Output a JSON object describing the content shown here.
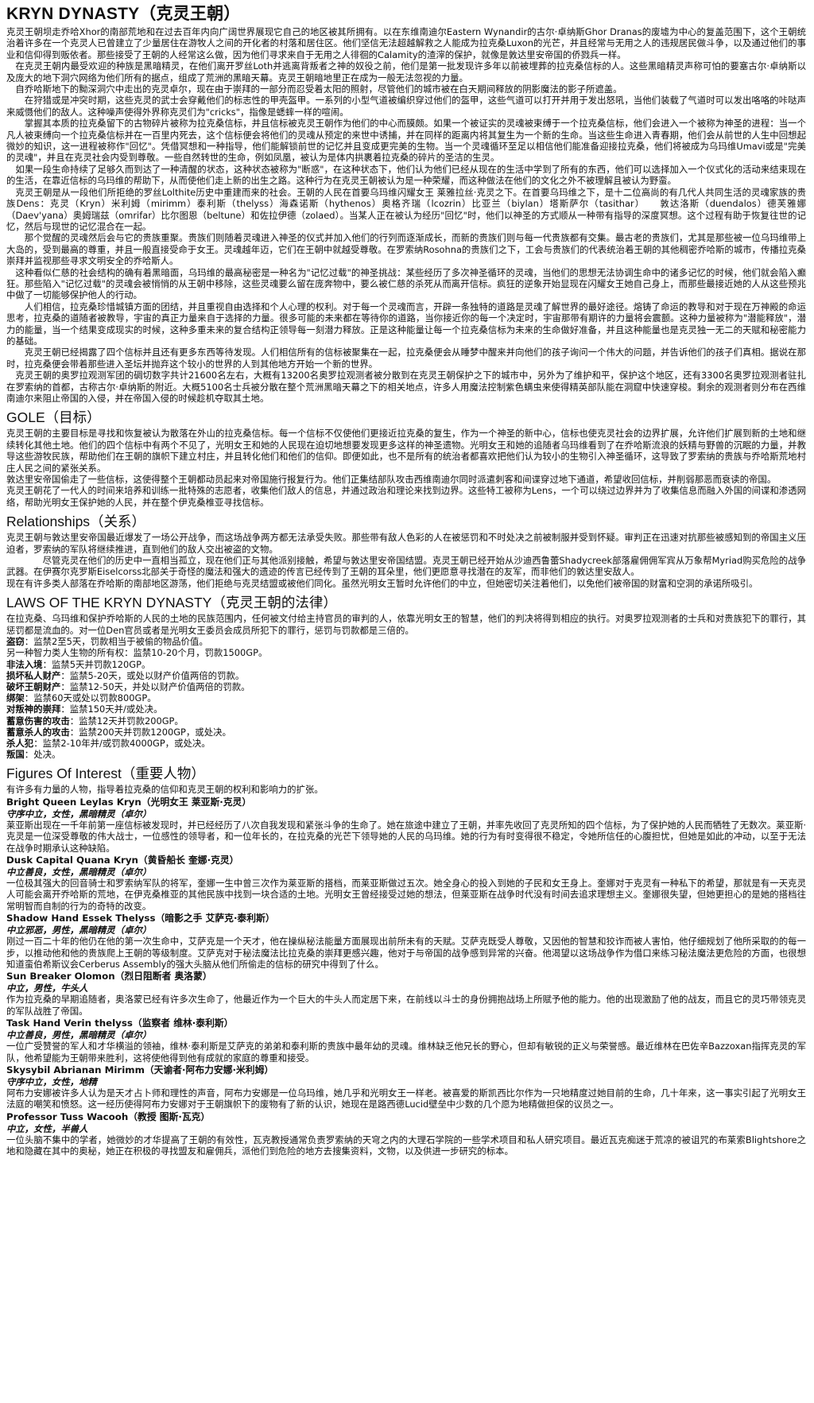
{
  "title": "KRYN DYNASTY（克灵王朝）",
  "intro_paragraphs": [
    {
      "cls": "",
      "text": "克灵王朝坝走乔哈Xhor的南部荒地和在过去百年内向广阔世界展现它自己的地区被其所拥有。以在东维南迪尔Eastern Wynandir的古尔·卓纳斯Ghor Dranas的废墟为中心的复盖范围下，这个王朝统治着许多在一个克灵人已曾建立了少量居住在游牧人之间的开化者的村落和居住区。他们坚信无法超越解救之人能成为拉克桑Luxon的光芒，并且经常与无用之人的违规居民做斗争，以及通过他们的事业和信仰得到贩依者。那些接受了王朝的人经常这么做，因为他们寻求来自于无用之人徘徊的Calamity的渣滓的保护，就像是敦达里安帝国的侨戮兵一样。"
    },
    {
      "cls": "ind",
      "text": "在克灵王朝内最受欢迎的种族是黑暗精灵，在他们离开罗丝Loth并逃离背叛者之神的奴役之前，他们是第一批发现许多年以前被埋葬的拉克桑信标的人。这些黑暗精灵声称可怕的要塞古尔·卓纳斯以及庞大的地下洞穴网络为他们所有的据点，组成了荒洲的黑暗天幕。克灵王朝暗地里正在成为一般无法忽视的力量。"
    },
    {
      "cls": "ind",
      "text": "自乔哈斯地下的黝深洞穴中走出的克灵卓尔，现在由于崇拜的一部分而忍受着太阳的照射，尽管他们的城市被在白天期间释放的阴影魔法的影子所遮盖。"
    },
    {
      "cls": "ind2",
      "text": "在狩猎或是冲突时期，这些克灵的武士会穿戴他们的标志性的甲壳盔甲。一系列的小型气道被编织穿过他们的盔甲，这些气道可以打开并用于发出怒吼，当他们装载了气道时可以发出咯咯的咔哒声来威慑他们的敌人。这种噪声使得外界称克灵们为\"cricks\"，指像是蟋蟀一样的喧闹。"
    },
    {
      "cls": "ind2",
      "text": "掌握其本质的拉克桑留下的古物碎片被称为拉克桑信标，并且信标被克灵王朝作为他们的中心而膜颇。如果一个被证实的灵魂被束缚于一个拉克桑信标，他们会进入一个被称为神圣的进程：当一个凡人被束缚向一个拉克桑信标并在一百里内死去，这个信标便会将他们的灵魂从预定的来世中诱捕，并在同样的距离内将其复生为一个新的生命。当这些生命进入青春期，他们会从前世的人生中回想起微妙的知识，这一进程被称作\"回忆\"。凭借冥想和一种指导，他们能解锁前世的记忆并且变成更完美的生物。当一个灵魂循环至足以相信他们能准备迎接拉克桑，他们将被成为乌玛维Umavi或是\"完美的灵魂\"，并且在克灵社会内受到尊敬。一些自然转世的生命，例如凤凰，被认为是体内拱裹着拉克桑的碎片的圣洁的生灵。"
    },
    {
      "cls": "ind",
      "text": "如果一段生命持续了足够久而到达了一种清醒的状态，这种状态被称为\"断惑\"，在这种状态下，他们认为他们已经从现在的生活中学到了所有的东西，他们可以选择加入一个仪式化的活动来结束现在的生活，在靠近信标的乌玛维的帮助下，从而使他们走上新的出生之路。这种行为在克灵王朝被认为是一种荣耀，而这种做法在他们的文化之外不被理解且被认为野蛮。"
    },
    {
      "cls": "ind",
      "text": "克灵王朝是从一段他们所拒绝的罗丝Lolthite历史中重建而来的社会。王朝的人民在首要乌玛维闪耀女王 莱雅拉丝·克灵之下。在首要乌玛维之下，是十二位高尚的有几代人共同生活的灵魂家族的贵族Dens：克灵（Kryn）米利姆（mirimm）泰利斯（thelyss）海森诺斯（hythenos）奥格齐瑞（lcozrin）比亚兰（biylan）塔斯萨尔（tasithar）　　敦达洛斯（duendalos）德芙雅娜（Daev'yana）奥姆瑞兹（omrifar）比尔图恩（beltune）和佐拉伊德（zolaed）。当某人正在被认为经历\"回忆\"时，他们以神圣的方式顺从一种带有指导的深度冥想。这个过程有助于恢复往世的记忆，然后与现世的记忆混合在一起。"
    },
    {
      "cls": "ind2",
      "text": "那个觉醒的灵魂然后会与它的贵族重聚。贵族们则随着灵魂进入神圣的仪式并加入他们的行列而逐渐成长，而新的贵族们则与每一代贵族都有交集。最古老的贵族们，尤其是那些被一位乌玛维带上大岛的，受到最高的尊重，并且一般直接受命于女王。灵魂越年迈，它们在王朝中就越受尊敬。在罗索纳Rosohna的贵族们之下，工会与贵族们的代表统治着王朝的其他稠密乔哈斯的城市，传播拉克桑崇拜并监视那些寻求文明安全的乔哈斯人。"
    },
    {
      "cls": "ind",
      "text": "这种看似仁慈的社会结构的确有着黑暗面，乌玛维的最高秘密是一种名为\"记忆过载\"的神圣挑战：某些经历了多次神圣循环的灵魂，当他们的思想无法协调生命中的诸多记忆的时候，他们就会陷入癫狂。那些陷入\"记忆过载\"的灵魂会被悄悄的从王朝中移除，这些灵魂要么留在庞奔物中，要么被仁慈的杀死从而离开信标。疯狂的逆象开始显现在闪耀女王她自己身上，而那些最接近她的人从这些预兆中做了一切能够保护他人的行动。"
    },
    {
      "cls": "ind2",
      "text": "人们相信，拉克桑珍惜城镇方面的团结，并且重视自由选择和个人心理的权利。对于每一个灵魂而言，开辟一条独特的道路是灵魂了解世界的最好途径。熔铸了命运的教导和对于现在万神殿的命运思考，拉克桑的道随者被教导，宇宙的真正力量来自于选择的力量。很多可能的未来都在等待你的道路，当你接近你的每一个决定时，宇宙那带有期许的力量将会震颤。这种力量被称为\"潜能释放\"，潜力的能量，当一个结果变成现实的时候，这种多重未来的复合结构正领导每一刻潜力释放。正是这种能量让每一个拉克桑信标为未来的生命做好准备，并且这种能量也是克灵独一无二的天赋和秘密能力的基础。"
    },
    {
      "cls": "ind2",
      "text": "克灵王朝已经揭露了四个信标并且还有更多东西等待发现。人们相信所有的信标被聚集在一起，拉克桑便会从睡梦中醒来并向他们的孩子询问一个伟大的问题，并告诉他们的孩子们真相。据说在那时，拉克桑便会带着那些进入圣坛并抛弃这个较小的世界的人到其他地方开始一个新的世界。"
    },
    {
      "cls": "ind",
      "text": "克灵王朝的奥罗拉观测军团的碉切数字共计21600名左右，大概有13200名奥罗拉观测者被分散到在克灵王朝保护之下的城市中，另外为了维护和平，保护这个地区，还有3300名奥罗拉观测者驻扎在罗索纳的首都，古称古尔·卓纳斯的附近。大概5100名士兵被分散在整个荒洲黑暗天幕之下的相关地点，许多人用魔法控制紫色螨虫来使得精英部队能在洞窟中快速穿梭。剩余的观测者则分布在西维南迪尔来阻止帝国的入侵，并在帝国入侵的时候趁机夺取其土地。"
    }
  ],
  "goal": {
    "heading": "GOLE（目标）",
    "paragraphs": [
      "克灵王朝的主要目标是寻找和恢复被认为散落在外山的拉克桑信标。每一个信标不仅使他们更接近拉克桑的复生，作为一个神圣的新中心，信标也使克灵社会的边界扩展，允许他们扩展到新的土地和继续转化其他土地。他们的四个信标中有两个不见了，光明女王和她的人民现在迫切地想要发现更多这样的神圣遗物。光明女王和她的追随者乌玛维看到了在乔哈斯流浪的妖精与野兽的沉眠的力量，并教导这些游牧民族，帮助他们在王朝的旗帜下建立村庄，并且转化他们和他们的信仰。即便如此，也不是所有的统治者都喜欢把他们认为较小的生物引入神圣循环，这导致了罗索纳的贵族与乔哈斯荒地村庄人民之间的紧张关系。",
      "敦达里安帝国偷走了一些信标，这使得整个王朝都动员起来对帝国施行报复行为。他们正集结部队攻击西维南迪尔同时派遣刺客和间谍穿过地下通道，希望收回信标，并削弱那恶而衰读的帝国。",
      "克灵王朝花了一代人的时间来培养和训练一批特殊的志愿者，收集他们敌人的信息，并通过政治和理论来找到边界。这些特工被称为Lens，一个可以绕过边界并为了收集信息而融入外国的间谍和渗透网络，帮助光明女王保护她的人民，并在整个伊克桑椎亚寻找信标。"
    ]
  },
  "relationships": {
    "heading": "Relationships（关系）",
    "paragraphs": [
      {
        "cls": "",
        "text": "克灵王朝与敦达里安帝国最近爆发了一场公开战争，而这场战争两方都无法承受失败。那些带有敌人色彩的人在被惩罚和不时处决之前被制服并受到怀疑。审判正在迅速对抗那些被感知到的帝国主义压迫者，罗索纳的军队将继续推进，直到他们的敌人交出被盗的文物。"
      },
      {
        "cls": "ind",
        "text": "　　　尽管克灵在他们的历史中一直相当孤立，现在他们正与其他派别接触，希望与敦达里安帝国结盟。克灵王朝已经开始从沙迪西鲁蕾Shadycreek部落雇佣佣军宾从万象帮Myriad购买危险的战争武器。在伊赛尔克罗斯Eiselcorss北部关于奇怪的魔法和强大的遗迹的传言已经传到了王朝的耳朵里，他们更愿意寻找潜在的友军，而非他们的敦达里安敌人。"
      },
      {
        "cls": "",
        "text": "现在有许多类人部落在乔哈斯的南部地区游荡，他们拒绝与克灵结盟或被他们同化。虽然光明女王暂时允许他们的中立，但她密切关注着他们，以免他们被帝国的财富和空洞的承诺所吸引。"
      }
    ]
  },
  "laws": {
    "heading": "LAWS OF THE KRYN DYNASTY（克灵王朝的法律）",
    "intro": "在拉克桑、乌玛维和保护乔哈斯的人民的土地的民族范围内，任何被文付给主持官员的审判的人，依靠光明女王的智慧，他们的判决将得到相应的执行。对奥罗拉观测者的士兵和对贵族犯下的罪行，其惩罚都是流血的。对一位Den官员或者是光明女王委员会成员所犯下的罪行，惩罚与罚款都是三倍的。",
    "items": [
      {
        "name": "盗窃",
        "text": "：监禁2至5天，罚款相当于被偷的物品价值。"
      },
      {
        "name": "",
        "text": "另一种智力类人生物的所有权：监禁10-20个月，罚款1500GP。"
      },
      {
        "name": "非法入境",
        "text": "：监禁5天并罚款120GP。"
      },
      {
        "name": "损坏私人财产",
        "text": "：监禁5-20天，或处以财产价值两倍的罚款。"
      },
      {
        "name": "破坏王朝财产",
        "text": "：监禁12-50天，并处以财产价值两倍的罚款。"
      },
      {
        "name": "绑架",
        "text": "：监禁60天或处以罚款800GP。"
      },
      {
        "name": "对叛神的崇拜",
        "text": "：监禁150天并/或处决。"
      },
      {
        "name": "蓄意伤害的攻击",
        "text": "：监禁12天并罚款200GP。"
      },
      {
        "name": "蓄意杀人的攻击",
        "text": "：监禁200天并罚款1200GP，或处决。"
      },
      {
        "name": "杀人犯",
        "text": "：监禁2-10年并/或罚款4000GP，或处决。"
      },
      {
        "name": "叛国",
        "text": "：处决。"
      }
    ]
  },
  "figures": {
    "heading": "Figures Of Interest（重要人物）",
    "intro": "有许多有力量的人物，指导着拉克桑的信仰和克灵王朝的权利和影响力的扩张。",
    "people": [
      {
        "name": "Bright Queen Leylas Kryn（光明女王 莱亚斯·克灵）",
        "meta": "守序中立，女性，黑暗精灵（卓尔）",
        "desc": "莱亚斯出现在一千年前第一座信标被发现时，并已经经历了八次自我发现和紧张斗争的生命了。她在旅途中建立了王朝，并率先收回了克灵所知的四个信标，为了保护她的人民而牺牲了无数次。莱亚斯·克灵是一位深受尊敬的伟大战士，一位感性的领导者，和一位年长的，在拉克桑的光芒下领导她的人民的乌玛维。她的行为有时变得很不稳定，令她所信任的心腹担忧，但她是如此的冲动，以至于无法在战争时期承认这种缺陷。"
      },
      {
        "name": "Dusk Capital Quana Kryn（黄昏船长 奎娜·克灵）",
        "meta": "中立善良，女性，黑暗精灵（卓尔）",
        "desc": "一位极其强大的回音骑士和罗索纳军队的将军，奎娜一生中曾三次作为莱亚斯的搭档，而莱亚斯做过五次。她全身心的投入到她的子民和女王身上。奎娜对于克灵有一种私下的希望，那就是有一天克灵人可能会离开乔哈斯的荒地，在伊克桑椎亚的其他民族中找到一块合适的土地。光明女王曾经接受过她的想法，但莱亚斯在战争时代没有时间去追求理想主义。奎娜很失望，但她更担心的是她的搭档往常明智而自制的行为的奇特的改变。"
      },
      {
        "name": "Shadow Hand Essek Thelyss（暗影之手 艾萨克·泰利斯）",
        "meta": "中立邪恶，男性，黑暗精灵（卓尔）",
        "desc": "刚过一百二十年的他仍在他的第一次生命中，艾萨克是一个天才，他在操纵秘法能量方面展现出前所未有的天赋。艾萨克既受人尊敬，又因他的智慧和狡诈而被人害怕，他仔细规划了他所采取的的每一步，以推动他和他的贵族爬上王朝的等级制度。艾萨克对于秘法魔法比拉克桑的崇拜更感兴趣，他对于与帝国的战争感到异常的兴奋。他渴望以这场战争作为借口来练习秘法魔法更危险的方面，也很想知道蛮伯希斯议会Cerberus Assembly的强大头脑从他们所偷走的信标的研究中得到了什么。"
      },
      {
        "name": "Sun Breaker Olomon（烈日阻断者 奥洛蒙）",
        "meta": "中立，男性，牛头人",
        "desc": "作为拉克桑的早期追随者，奥洛蒙已经有许多次生命了，他最近作为一个巨大的牛头人而定居下来，在前线以斗士的身份拥抱战场上所赋予他的能力。他的出现激励了他的战友，而且它的灵巧带领克灵的军队战胜了帝国。"
      },
      {
        "name": "Task Hand Verin thelyss（监察者 维林·泰利斯）",
        "meta": "中立善良，男性，黑暗精灵（卓尔）",
        "desc": "一位广受赞誉的军人和才华横溢的领袖，维林·泰利斯是艾萨克的弟弟和泰利斯的贵族中最年幼的灵魂。维林缺乏他兄长的野心，但却有敏锐的正义与荣誉感。最近维林在巴佐辛Bazzoxan指挥克灵的军队，他希望能为王朝带来胜利，这将使他得到他有成就的家庭的尊重和接受。"
      },
      {
        "name": "Skysybil Abrianan Mirimm（天谕者·阿布力安娜·米利姆）",
        "meta": "守序中立，女性，地精",
        "desc": "阿布力安娜被许多人认为是天才占卜师和理性的声音，阿布力安娜是一位乌玛维，她几乎和光明女王一样老。被喜爱的斯凯西比尔作为一只地精度过她目前的生命，几十年来，这一事实引起了光明女王法庭的嘲笑和愤怒。这一经历使得阿布力安娜对于王朝旗帜下的废物有了新的认识，她现在是路西德Lucid壁垒中少数的几个愿为地精做担保的议员之一。"
      },
      {
        "name": "Professor Tuss Wacooh（教授 图斯·瓦克）",
        "meta": "中立，女性，半兽人",
        "desc": "一位头脑不集中的学者，她微妙的才华提高了王朝的有效性，瓦克教授通常负责罗索纳的天穹之内的大理石学院的一些学术项目和私人研究项目。最近瓦克痴迷于荒凉的被诅咒的布莱索Blightshore之地和隐藏在其中的奥秘，她正在积极的寻找盟友和雇佣兵，派他们到危险的地方去搜集资料，文物，以及供进一步研究的标本。"
      }
    ]
  }
}
